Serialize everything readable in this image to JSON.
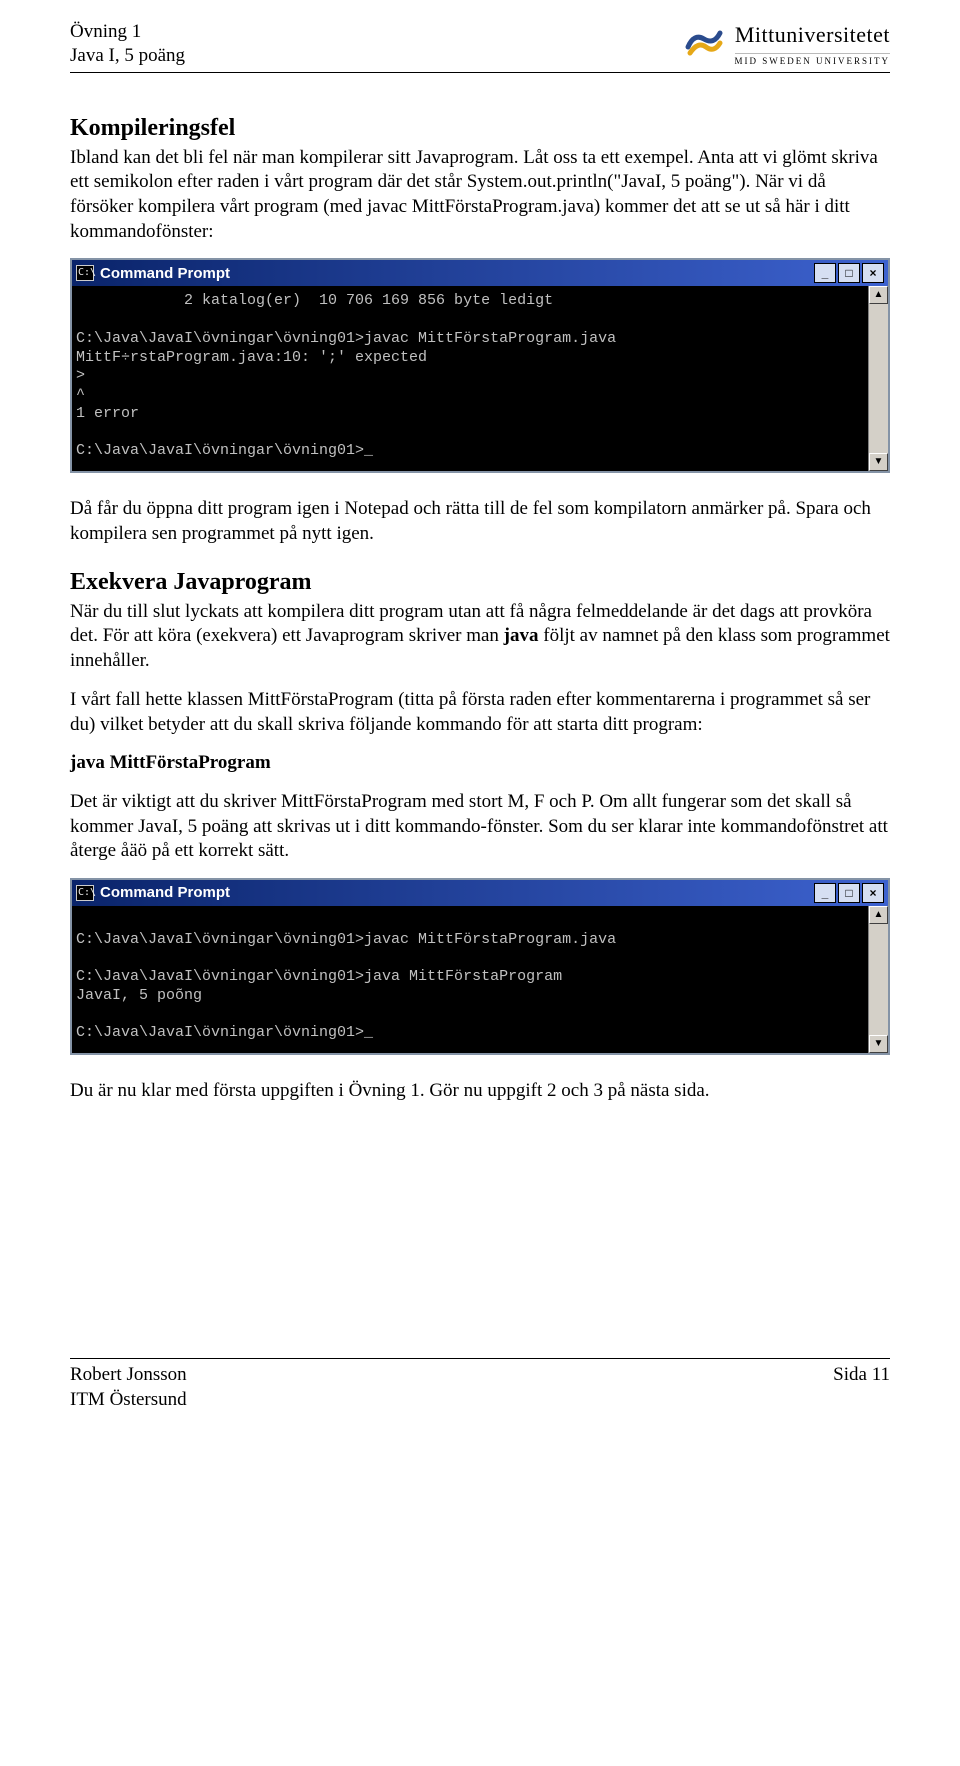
{
  "header": {
    "line1": "Övning 1",
    "line2": "Java I, 5 poäng",
    "logo_name": "Mittuniversitetet",
    "logo_sub": "MID SWEDEN UNIVERSITY"
  },
  "sections": {
    "title1": "Kompileringsfel",
    "p1": "Ibland kan det bli fel när man kompilerar sitt Javaprogram. Låt oss ta ett exempel. Anta att vi glömt skriva ett semikolon efter raden i vårt program där det står System.out.println(\"JavaI, 5 poäng\"). När vi då försöker kompilera vårt program (med javac MittFörstaProgram.java) kommer det att se ut så här i ditt kommandofönster:",
    "p2": "Då får du öppna ditt program igen i Notepad och rätta till de fel som kompilatorn anmärker på. Spara och kompilera sen programmet på nytt igen.",
    "title2": "Exekvera Javaprogram",
    "p3a": "När du till slut lyckats att kompilera ditt program utan att få några felmeddelande är det dags att provköra det. För att köra (exekvera) ett Javaprogram skriver man ",
    "p3b": "java",
    "p3c": " följt av namnet på den klass som programmet innehåller.",
    "p4": "I vårt fall hette klassen MittFörstaProgram (titta på första raden efter kommentarerna i programmet så ser du) vilket betyder att du skall skriva följande kommando för att starta ditt program:",
    "cmdline": "java MittFörstaProgram",
    "p5": "Det är viktigt att du skriver MittFörstaProgram med stort M, F och P. Om allt fungerar som det skall så kommer JavaI, 5 poäng att skrivas ut i ditt kommando-fönster. Som du ser klarar inte kommandofönstret att återge åäö på ett korrekt sätt.",
    "p6": "Du är nu klar med första uppgiften i Övning 1. Gör nu uppgift 2 och 3 på nästa sida."
  },
  "cmd": {
    "title": "Command Prompt",
    "icon": "C:\\",
    "min": "_",
    "max": "□",
    "close": "×",
    "arrow_up": "▲",
    "arrow_down": "▼",
    "body1": "            2 katalog(er)  10 706 169 856 byte ledigt\n\nC:\\Java\\JavaI\\övningar\\övning01>javac MittFörstaProgram.java\nMittF÷rstaProgram.java:10: ';' expected\n>\n^\n1 error\n\nC:\\Java\\JavaI\\övningar\\övning01>_",
    "body2": "\nC:\\Java\\JavaI\\övningar\\övning01>javac MittFörstaProgram.java\n\nC:\\Java\\JavaI\\övningar\\övning01>java MittFörstaProgram\nJavaI, 5 poõng\n\nC:\\Java\\JavaI\\övningar\\övning01>_"
  },
  "footer": {
    "author": "Robert Jonsson",
    "dept": "ITM Östersund",
    "page": "Sida 11"
  }
}
